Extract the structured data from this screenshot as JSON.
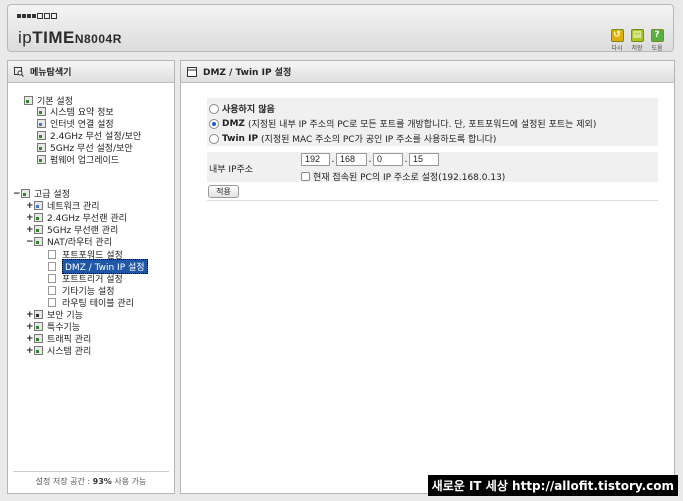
{
  "header": {
    "brand_prefix": "ip",
    "brand_bold": "TIME",
    "model": "N8004R",
    "buttons": [
      {
        "label": "다시",
        "icon": "undo-icon",
        "color": "#e0b000",
        "glyph": "↺"
      },
      {
        "label": "저장",
        "icon": "save-icon",
        "color": "#a8c820",
        "glyph": "▤"
      },
      {
        "label": "도움",
        "icon": "help-icon",
        "color": "#58b040",
        "glyph": "?"
      }
    ]
  },
  "sidebar": {
    "title": "메뉴탐색기",
    "basic": {
      "label": "기본 설정",
      "items": [
        "시스템 요약 정보",
        "인터넷 연결 설정",
        "2.4GHz 무선 설정/보안",
        "5GHz 무선 설정/보안",
        "펌웨어 업그레이드"
      ]
    },
    "advanced": {
      "label": "고급 설정",
      "groups": [
        {
          "label": "네트워크 관리",
          "toggle": "+"
        },
        {
          "label": "2.4GHz 무선랜 관리",
          "toggle": "+"
        },
        {
          "label": "5GHz 무선랜 관리",
          "toggle": "+"
        },
        {
          "label": "NAT/라우터 관리",
          "toggle": "−"
        }
      ],
      "nat_items": [
        "포트포워드 설정",
        "DMZ / Twin IP 설정",
        "포트트리거 설정",
        "기타기능 설정",
        "라우팅 테이블 관리"
      ],
      "nat_selected": "DMZ / Twin IP 설정",
      "groups2": [
        {
          "label": "보안 기능",
          "toggle": "+"
        },
        {
          "label": "특수기능",
          "toggle": "+"
        },
        {
          "label": "트래픽 관리",
          "toggle": "+"
        },
        {
          "label": "시스템 관리",
          "toggle": "+"
        }
      ]
    },
    "footer_prefix": "설정 저장 공간 : ",
    "footer_value": "93%",
    "footer_suffix": " 사용 가능"
  },
  "main": {
    "title": "DMZ / Twin IP 설정",
    "options": [
      {
        "bold": "사용하지 않음",
        "desc": "",
        "selected": false
      },
      {
        "bold": "DMZ",
        "desc": "(지정된 내부 IP 주소의 PC로 모든 포트를 개방합니다. 단, 포트포워드에 설정된 포트는 제외)",
        "selected": true
      },
      {
        "bold": "Twin IP",
        "desc": "(지정된 MAC 주소의 PC가 공인 IP 주소를 사용하도록 합니다)",
        "selected": false
      }
    ],
    "ip_label": "내부 IP주소",
    "ip_octets": [
      "192",
      "168",
      "0",
      "15"
    ],
    "current_ip_label": "현재 접속된 PC의 IP 주소로 설정(192.168.0.13)",
    "apply_label": "적용"
  },
  "watermark": "새로운 IT 세상 http://allofit.tistory.com"
}
